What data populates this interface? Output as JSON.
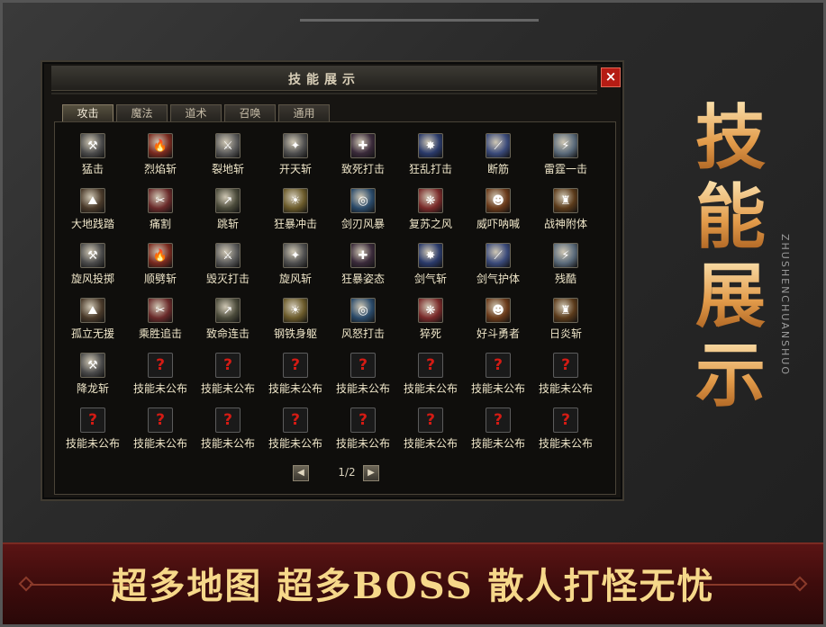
{
  "panel": {
    "title": "技能展示",
    "close": "×"
  },
  "tabs": [
    {
      "label": "攻击"
    },
    {
      "label": "魔法"
    },
    {
      "label": "道术"
    },
    {
      "label": "召唤"
    },
    {
      "label": "通用"
    }
  ],
  "active_tab": "攻击",
  "skills": [
    "猛击",
    "烈焰斩",
    "裂地斩",
    "开天斩",
    "致死打击",
    "狂乱打击",
    "断筋",
    "雷霆一击",
    "大地践踏",
    "痛割",
    "跳斩",
    "狂暴冲击",
    "剑刃风暴",
    "复苏之风",
    "威吓呐喊",
    "战神附体",
    "旋风投掷",
    "顺劈斩",
    "毁灭打击",
    "旋风斩",
    "狂暴姿态",
    "剑气斩",
    "剑气护体",
    "残酷",
    "孤立无援",
    "乘胜追击",
    "致命连击",
    "钢铁身躯",
    "风怒打击",
    "猝死",
    "好斗勇者",
    "日炎斩",
    "降龙斩",
    "技能未公布",
    "技能未公布",
    "技能未公布",
    "技能未公布",
    "技能未公布",
    "技能未公布",
    "技能未公布",
    "技能未公布",
    "技能未公布",
    "技能未公布",
    "技能未公布",
    "技能未公布",
    "技能未公布",
    "技能未公布",
    "技能未公布"
  ],
  "unknown_label": "技能未公布",
  "pager": {
    "text": "1/2",
    "prev_icon": "arrow-left-icon",
    "next_icon": "arrow-right-icon"
  },
  "promo": {
    "title_chars": [
      "技",
      "能",
      "展",
      "示"
    ],
    "vertical": "ZHUSHENCHUANSHUO"
  },
  "banner": {
    "text": "超多地图 超多BOSS 散人打怪无忧"
  },
  "colors": {
    "accent_gold": "#f6d88a",
    "banner_red": "#5a1414",
    "close_red": "#b51c14"
  }
}
